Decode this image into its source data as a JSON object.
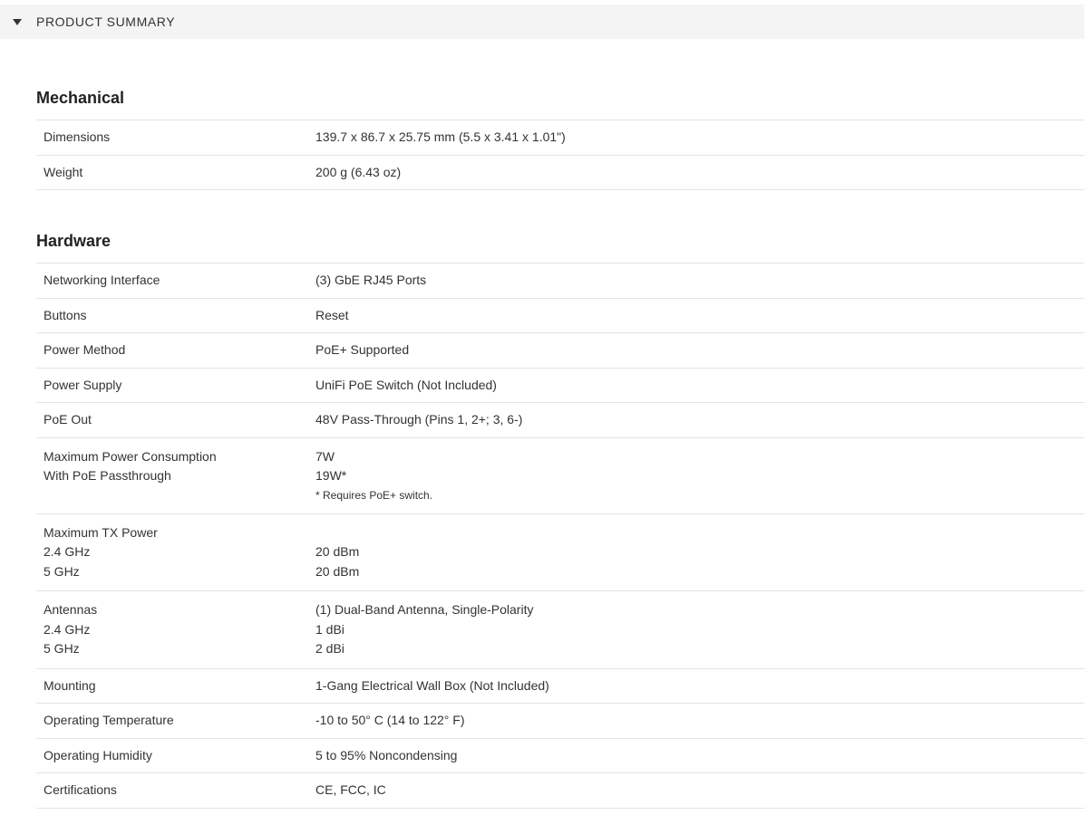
{
  "summary": {
    "title": "PRODUCT SUMMARY",
    "caret_icon": "caret-down-icon"
  },
  "mechanical": {
    "title": "Mechanical",
    "rows": [
      {
        "label": "Dimensions",
        "value": "139.7 x 86.7 x 25.75 mm (5.5 x 3.41 x 1.01\")"
      },
      {
        "label": "Weight",
        "value": "200 g (6.43 oz)"
      }
    ]
  },
  "hardware": {
    "title": "Hardware",
    "networking": {
      "label": "Networking Interface",
      "value": "(3) GbE RJ45 Ports"
    },
    "buttons": {
      "label": "Buttons",
      "value": "Reset"
    },
    "power_method": {
      "label": "Power Method",
      "value": "PoE+ Supported"
    },
    "power_supply": {
      "label": "Power Supply",
      "value": "UniFi PoE Switch (Not Included)"
    },
    "poe_out": {
      "label": "PoE Out",
      "value": "48V Pass-Through (Pins 1, 2+; 3, 6-)"
    },
    "max_power": {
      "label_1": "Maximum Power Consumption",
      "label_2": "With PoE Passthrough",
      "value_1": "7W",
      "value_2": "19W*",
      "note": "* Requires PoE+ switch."
    },
    "tx_power": {
      "label": "Maximum TX Power",
      "label_24": "2.4 GHz",
      "label_5": "5 GHz",
      "value_24": "20 dBm",
      "value_5": "20 dBm"
    },
    "antennas": {
      "label": "Antennas",
      "label_24": "2.4 GHz",
      "label_5": "5 GHz",
      "value": "(1) Dual-Band Antenna, Single-Polarity",
      "value_24": "1 dBi",
      "value_5": "2 dBi"
    },
    "mounting": {
      "label": "Mounting",
      "value": "1-Gang Electrical Wall Box (Not Included)"
    },
    "op_temp": {
      "label": "Operating Temperature",
      "value": "-10 to 50° C (14 to 122° F)"
    },
    "op_humidity": {
      "label": "Operating Humidity",
      "value": "5 to 95% Noncondensing"
    },
    "certifications": {
      "label": "Certifications",
      "value": "CE, FCC, IC"
    }
  }
}
